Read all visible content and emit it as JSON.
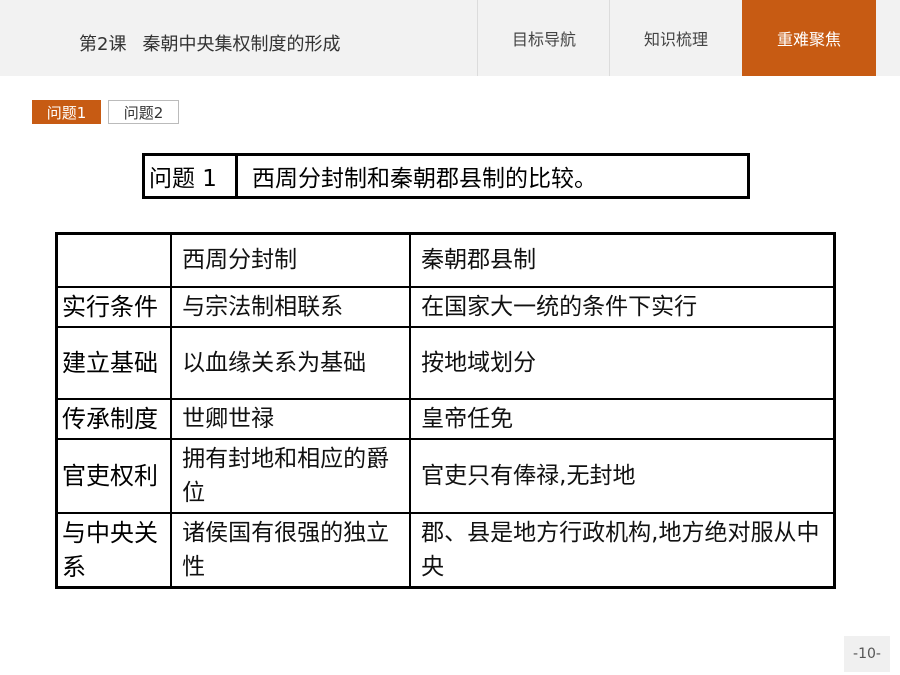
{
  "header": {
    "lesson_number": "第2课",
    "lesson_title": "秦朝中央集权制度的形成",
    "tabs": [
      {
        "label": "目标导航"
      },
      {
        "label": "知识梳理"
      },
      {
        "label": "重难聚焦"
      }
    ]
  },
  "subtabs": [
    "问题1",
    "问题2"
  ],
  "question": {
    "label": "问题 1",
    "text": "西周分封制和秦朝郡县制的比较。"
  },
  "table": {
    "headers": [
      "",
      "西周分封制",
      "秦朝郡县制"
    ],
    "rows": [
      {
        "aspect": "实行条件",
        "zhou": "与宗法制相联系",
        "qin": "在国家大一统的条件下实行"
      },
      {
        "aspect": "建立基础",
        "zhou": "以血缘关系为基础",
        "qin": "按地域划分"
      },
      {
        "aspect": "传承制度",
        "zhou": "世卿世禄",
        "qin": "皇帝任免"
      },
      {
        "aspect": "官吏权利",
        "zhou": "拥有封地和相应的爵位",
        "qin": "官吏只有俸禄,无封地"
      },
      {
        "aspect": "与中央关系",
        "zhou": "诸侯国有很强的独立性",
        "qin": "郡、县是地方行政机构,地方绝对服从中央"
      }
    ]
  },
  "page_number": "-10-",
  "colors": {
    "accent": "#c75b13",
    "header_bg": "#f2f2f2"
  }
}
